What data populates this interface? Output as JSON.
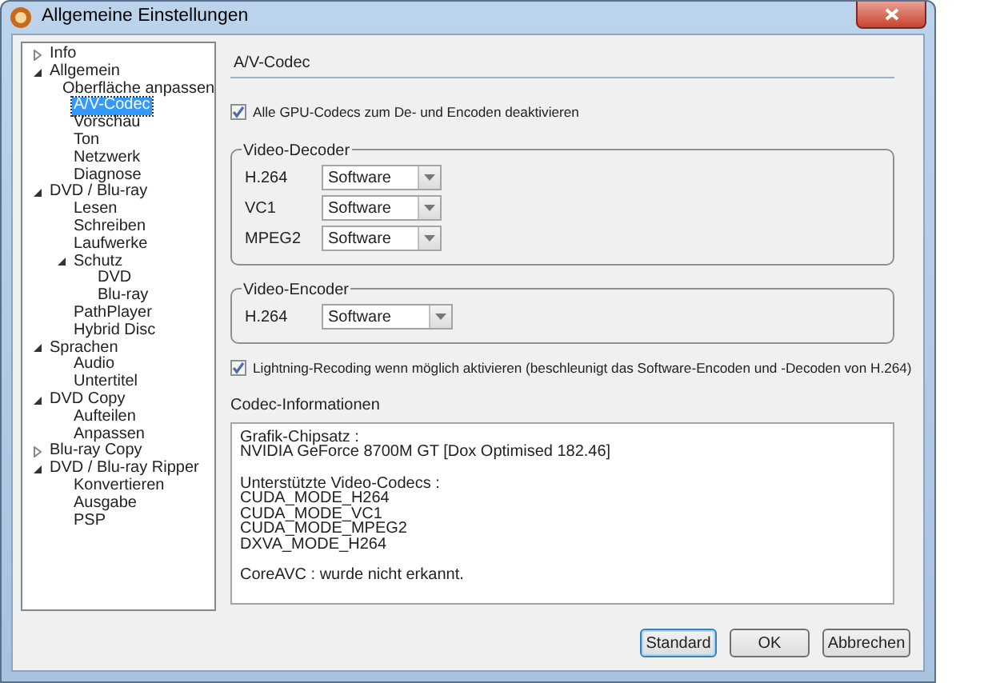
{
  "window": {
    "title": "Allgemeine Einstellungen"
  },
  "tree": [
    {
      "label": "Info",
      "expanded": false,
      "selected": false
    },
    {
      "label": "Allgemein",
      "expanded": true,
      "selected": false,
      "children": [
        {
          "label": "Oberfläche anpassen",
          "selected": false
        },
        {
          "label": "A/V-Codec",
          "selected": true
        },
        {
          "label": "Vorschau",
          "selected": false
        },
        {
          "label": "Ton",
          "selected": false
        },
        {
          "label": "Netzwerk",
          "selected": false
        },
        {
          "label": "Diagnose",
          "selected": false
        }
      ]
    },
    {
      "label": "DVD / Blu-ray",
      "expanded": true,
      "selected": false,
      "children": [
        {
          "label": "Lesen",
          "selected": false
        },
        {
          "label": "Schreiben",
          "selected": false
        },
        {
          "label": "Laufwerke",
          "selected": false
        },
        {
          "label": "Schutz",
          "expanded": true,
          "selected": false,
          "children": [
            {
              "label": "DVD",
              "selected": false
            },
            {
              "label": "Blu-ray",
              "selected": false
            }
          ]
        },
        {
          "label": "PathPlayer",
          "selected": false
        },
        {
          "label": "Hybrid Disc",
          "selected": false
        }
      ]
    },
    {
      "label": "Sprachen",
      "expanded": true,
      "selected": false,
      "children": [
        {
          "label": "Audio",
          "selected": false
        },
        {
          "label": "Untertitel",
          "selected": false
        }
      ]
    },
    {
      "label": "DVD Copy",
      "expanded": true,
      "selected": false,
      "children": [
        {
          "label": "Aufteilen",
          "selected": false
        },
        {
          "label": "Anpassen",
          "selected": false
        }
      ]
    },
    {
      "label": "Blu-ray Copy",
      "expanded": false,
      "selected": false
    },
    {
      "label": "DVD / Blu-ray Ripper",
      "expanded": true,
      "selected": false,
      "children": [
        {
          "label": "Konvertieren",
          "selected": false
        },
        {
          "label": "Ausgabe",
          "selected": false
        },
        {
          "label": "PSP",
          "selected": false
        }
      ]
    }
  ],
  "section_title": "A/V-Codec",
  "disable_gpu": {
    "label": "Alle GPU-Codecs zum De- und Encoden deaktivieren",
    "checked": true
  },
  "groups": [
    {
      "title": "Video-Decoder",
      "rows": [
        {
          "label": "H.264",
          "value": "Software"
        },
        {
          "label": "VC1",
          "value": "Software"
        },
        {
          "label": "MPEG2",
          "value": "Software"
        }
      ]
    },
    {
      "title": "Video-Encoder",
      "rows": [
        {
          "label": "H.264",
          "value": "Software"
        }
      ]
    }
  ],
  "lightning": {
    "label": "Lightning-Recoding wenn möglich aktivieren (beschleunigt das Software-Encoden und -Decoden von H.264)",
    "checked": true
  },
  "codec_info": {
    "label": "Codec-Informationen",
    "paragraphs": [
      [
        "Grafik-Chipsatz :",
        "NVIDIA GeForce 8700M GT [Dox Optimised 182.46]"
      ],
      [
        "Unterstützte Video-Codecs :",
        "CUDA_MODE_H264",
        "CUDA_MODE_VC1",
        "CUDA_MODE_MPEG2",
        "DXVA_MODE_H264"
      ],
      [
        "CoreAVC : wurde nicht erkannt."
      ]
    ]
  },
  "buttons": [
    "Standard",
    "OK",
    "Abbrechen"
  ]
}
